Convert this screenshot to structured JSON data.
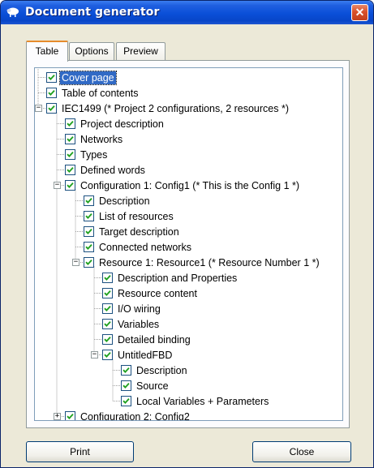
{
  "window": {
    "title": "Document generator",
    "close_glyph": "✕",
    "icon": "sheep-app-icon"
  },
  "tabs": [
    {
      "label": "Table",
      "active": true
    },
    {
      "label": "Options",
      "active": false
    },
    {
      "label": "Preview",
      "active": false
    }
  ],
  "tree": [
    {
      "label": "Cover page",
      "level": 1,
      "checked": true,
      "selected": true
    },
    {
      "label": "Table of contents",
      "level": 1,
      "checked": true
    },
    {
      "label": "IEC1499 (* Project 2 configurations, 2 resources *)",
      "level": 1,
      "checked": true,
      "expander": "−"
    },
    {
      "label": "Project description",
      "level": 2,
      "checked": true
    },
    {
      "label": "Networks",
      "level": 2,
      "checked": true
    },
    {
      "label": "Types",
      "level": 2,
      "checked": true
    },
    {
      "label": "Defined words",
      "level": 2,
      "checked": true
    },
    {
      "label": "Configuration 1: Config1 (* This is the Config 1 *)",
      "level": 2,
      "checked": true,
      "expander": "−"
    },
    {
      "label": "Description",
      "level": 3,
      "checked": true
    },
    {
      "label": "List of resources",
      "level": 3,
      "checked": true
    },
    {
      "label": "Target description",
      "level": 3,
      "checked": true
    },
    {
      "label": "Connected networks",
      "level": 3,
      "checked": true
    },
    {
      "label": "Resource 1: Resource1 (* Resource Number 1 *)",
      "level": 3,
      "checked": true,
      "expander": "−"
    },
    {
      "label": "Description and Properties",
      "level": 4,
      "checked": true
    },
    {
      "label": "Resource content",
      "level": 4,
      "checked": true
    },
    {
      "label": "I/O wiring",
      "level": 4,
      "checked": true
    },
    {
      "label": "Variables",
      "level": 4,
      "checked": true
    },
    {
      "label": "Detailed binding",
      "level": 4,
      "checked": true
    },
    {
      "label": "UntitledFBD",
      "level": 4,
      "checked": true,
      "expander": "−"
    },
    {
      "label": "Description",
      "level": 5,
      "checked": true
    },
    {
      "label": "Source",
      "level": 5,
      "checked": true
    },
    {
      "label": "Local Variables + Parameters",
      "level": 5,
      "checked": true
    },
    {
      "label": "Configuration 2: Config2",
      "level": 2,
      "checked": true,
      "expander": "+"
    }
  ],
  "buttons": {
    "print": "Print",
    "close": "Close"
  },
  "colors": {
    "selection": "#316ac5",
    "titlebar": "#0a4fd8",
    "tab_highlight": "#e68b2c",
    "checkmark": "#21a121"
  }
}
